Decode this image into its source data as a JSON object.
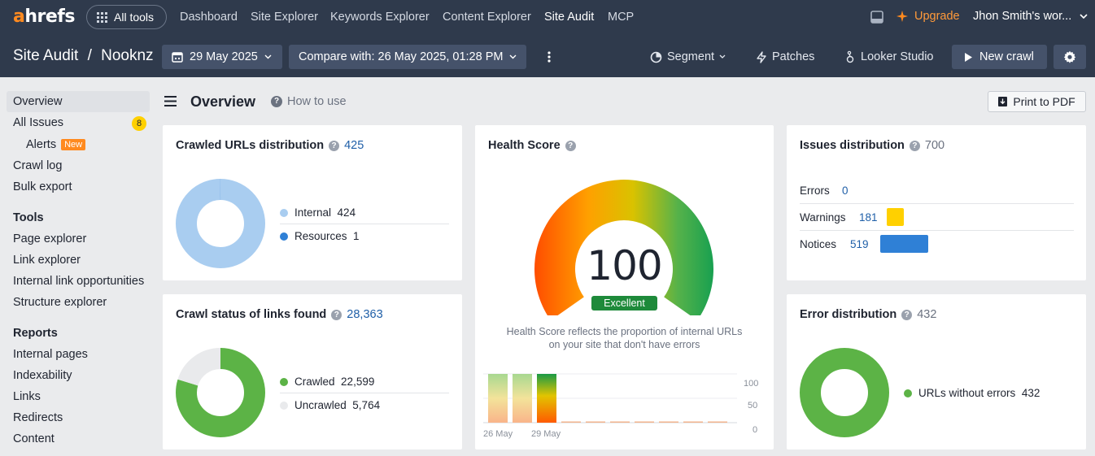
{
  "topbar": {
    "logo_a": "a",
    "logo_rest": "hrefs",
    "all_tools": "All tools",
    "nav": [
      "Dashboard",
      "Site Explorer",
      "Keywords Explorer",
      "Content Explorer",
      "Site Audit",
      "MCP"
    ],
    "upgrade": "Upgrade",
    "account": "Jhon Smith's wor..."
  },
  "subbar": {
    "title": "Site Audit",
    "sep": "/",
    "project": "Nooknz",
    "date": "29 May 2025",
    "compare": "Compare with: 26 May 2025, 01:28 PM",
    "segment": "Segment",
    "patches": "Patches",
    "looker": "Looker Studio",
    "new_crawl": "New crawl"
  },
  "sidebar": {
    "overview": "Overview",
    "all_issues": "All Issues",
    "all_issues_count": "8",
    "alerts": "Alerts",
    "alerts_badge": "New",
    "crawl_log": "Crawl log",
    "bulk_export": "Bulk export",
    "tools_head": "Tools",
    "tools": [
      "Page explorer",
      "Link explorer",
      "Internal link opportunities",
      "Structure explorer"
    ],
    "reports_head": "Reports",
    "reports": [
      "Internal pages",
      "Indexability",
      "Links",
      "Redirects",
      "Content"
    ]
  },
  "header": {
    "title": "Overview",
    "how_to": "How to use",
    "print": "Print to PDF"
  },
  "crawled": {
    "title": "Crawled URLs distribution",
    "total": "425",
    "legend": [
      {
        "label": "Internal",
        "value": "424",
        "color": "#a9cdf0"
      },
      {
        "label": "Resources",
        "value": "1",
        "color": "#2f80d6"
      }
    ],
    "values": [
      424,
      1
    ]
  },
  "crawl_status": {
    "title": "Crawl status of links found",
    "total": "28,363",
    "legend": [
      {
        "label": "Crawled",
        "value": "22,599",
        "color": "#5cb346"
      },
      {
        "label": "Uncrawled",
        "value": "5,764",
        "color": "#e9eaec"
      }
    ],
    "values": [
      22599,
      5764
    ]
  },
  "health": {
    "title": "Health Score",
    "score": "100",
    "score_value": 100,
    "badge": "Excellent",
    "desc1": "Health Score reflects the proportion of internal URLs",
    "desc2": "on your site that don't have errors",
    "y_ticks": [
      "100",
      "50",
      "0"
    ],
    "x_labels": [
      "26 May",
      "29 May"
    ],
    "bars": [
      100,
      100,
      100,
      0,
      0,
      0,
      0,
      0,
      0,
      0
    ]
  },
  "issues": {
    "title": "Issues distribution",
    "total": "700",
    "rows": [
      {
        "label": "Errors",
        "value": "0",
        "count": 0,
        "color": "#e04b3a"
      },
      {
        "label": "Warnings",
        "value": "181",
        "count": 181,
        "color": "#ffd000"
      },
      {
        "label": "Notices",
        "value": "519",
        "count": 519,
        "color": "#2f80d6"
      }
    ]
  },
  "errors": {
    "title": "Error distribution",
    "total": "432",
    "legend": [
      {
        "label": "URLs without errors",
        "value": "432",
        "color": "#5cb346"
      }
    ],
    "values": [
      432
    ]
  },
  "colors": {
    "topbar": "#2f3a4c",
    "accent": "#ff8a1f",
    "green": "#5cb346",
    "blue": "#2f80d6"
  }
}
